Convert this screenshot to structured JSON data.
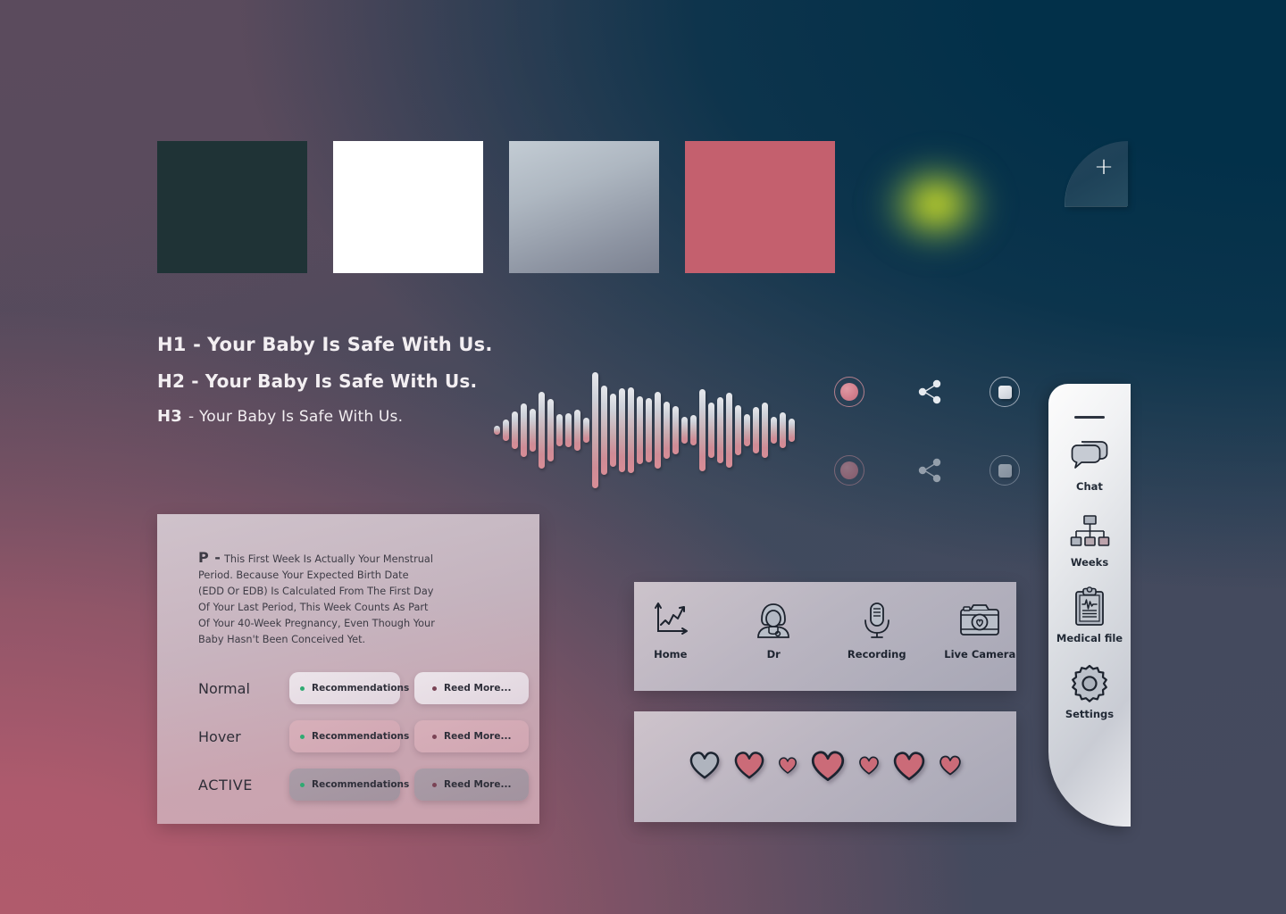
{
  "palette": {
    "swatches": [
      {
        "name": "dark-teal",
        "hex": "#1F3336"
      },
      {
        "name": "white",
        "hex": "#FFFFFF"
      },
      {
        "name": "silver-gradient",
        "hex": "#AEB7C1"
      },
      {
        "name": "rose",
        "hex": "#C4606E"
      },
      {
        "name": "lime-glow",
        "hex": "#D8E32A"
      }
    ],
    "add_button_label": "+",
    "background": {
      "top_left": "#5B4B5D",
      "top_right": "#023049",
      "bottom_left": "#AD5A6D",
      "bottom_right": "#454A5E"
    }
  },
  "typography": {
    "specimens": [
      {
        "tag": "H1 -",
        "text": "Your Baby Is Safe With Us."
      },
      {
        "tag": "H2 -",
        "text": "Your Baby Is Safe With Us."
      },
      {
        "tag": "H3",
        "text": "- Your Baby Is Safe With Us."
      }
    ]
  },
  "waveform": {
    "bars": [
      10,
      24,
      42,
      60,
      48,
      86,
      70,
      36,
      38,
      46,
      28,
      130,
      100,
      82,
      94,
      96,
      76,
      72,
      86,
      64,
      54,
      30,
      34,
      92,
      62,
      74,
      84,
      56,
      36,
      52,
      62,
      30,
      40,
      26
    ]
  },
  "media_controls": {
    "rows": [
      {
        "state": "normal",
        "buttons": [
          "record-button",
          "share-button",
          "stop-button"
        ]
      },
      {
        "state": "inactive",
        "buttons": [
          "record-button",
          "share-button",
          "stop-button"
        ]
      }
    ]
  },
  "component_card": {
    "paragraph": {
      "tag": "P -",
      "text": "This First Week Is Actually Your Menstrual Period. Because Your Expected Birth Date (EDD Or EDB) Is Calculated From The First Day Of Your Last Period, This Week Counts As Part Of Your 40-Week Pregnancy, Even Though Your Baby Hasn't Been Conceived Yet."
    },
    "states": [
      {
        "label": "Normal",
        "primary": "Recommendations",
        "secondary": "Reed More..."
      },
      {
        "label": "Hover",
        "primary": "Recommendations",
        "secondary": "Reed More..."
      },
      {
        "label": "ACTIVE",
        "primary": "Recommendations",
        "secondary": "Reed More..."
      }
    ],
    "dot_colors": {
      "primary": "#2FAA72",
      "secondary": "#7A4355"
    }
  },
  "bottom_nav": {
    "items": [
      {
        "label": "Home",
        "icon": "chart-line-icon"
      },
      {
        "label": "Dr",
        "icon": "doctor-icon"
      },
      {
        "label": "Recording",
        "icon": "microphone-icon"
      },
      {
        "label": "Live Camera",
        "icon": "camera-icon"
      }
    ]
  },
  "hearts_bar": {
    "hearts": [
      {
        "size": 36,
        "filled": false
      },
      {
        "size": 36,
        "filled": true
      },
      {
        "size": 22,
        "filled": true
      },
      {
        "size": 40,
        "filled": true
      },
      {
        "size": 24,
        "filled": true
      },
      {
        "size": 38,
        "filled": true
      },
      {
        "size": 26,
        "filled": true
      }
    ],
    "fill_color": "#CB6B78",
    "empty_color": "#AFB4BE"
  },
  "side_nav": {
    "items": [
      {
        "label": "Chat",
        "icon": "chat-bubbles-icon"
      },
      {
        "label": "Weeks",
        "icon": "hierarchy-icon"
      },
      {
        "label": "Medical file",
        "icon": "clipboard-heartbeat-icon"
      },
      {
        "label": "Settings",
        "icon": "gear-icon"
      }
    ]
  }
}
